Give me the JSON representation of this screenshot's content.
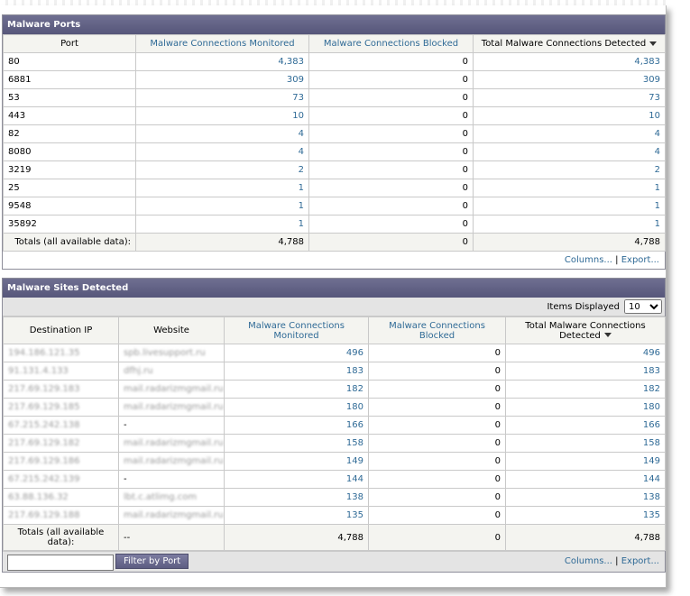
{
  "ports_panel": {
    "title": "Malware Ports",
    "headers": [
      "Port",
      "Malware Connections Monitored",
      "Malware Connections Blocked",
      "Total Malware Connections Detected"
    ],
    "rows": [
      {
        "port": "80",
        "monitored": "4,383",
        "blocked": "0",
        "total": "4,383"
      },
      {
        "port": "6881",
        "monitored": "309",
        "blocked": "0",
        "total": "309"
      },
      {
        "port": "53",
        "monitored": "73",
        "blocked": "0",
        "total": "73"
      },
      {
        "port": "443",
        "monitored": "10",
        "blocked": "0",
        "total": "10"
      },
      {
        "port": "82",
        "monitored": "4",
        "blocked": "0",
        "total": "4"
      },
      {
        "port": "8080",
        "monitored": "4",
        "blocked": "0",
        "total": "4"
      },
      {
        "port": "3219",
        "monitored": "2",
        "blocked": "0",
        "total": "2"
      },
      {
        "port": "25",
        "monitored": "1",
        "blocked": "0",
        "total": "1"
      },
      {
        "port": "9548",
        "monitored": "1",
        "blocked": "0",
        "total": "1"
      },
      {
        "port": "35892",
        "monitored": "1",
        "blocked": "0",
        "total": "1"
      }
    ],
    "totals": {
      "label": "Totals (all available data):",
      "monitored": "4,788",
      "blocked": "0",
      "total": "4,788"
    },
    "columns_link": "Columns...",
    "export_link": "Export..."
  },
  "sites_panel": {
    "title": "Malware Sites Detected",
    "items_label": "Items Displayed",
    "items_value": "10",
    "headers": [
      "Destination IP",
      "Website",
      "Malware Connections Monitored",
      "Malware Connections Blocked",
      "Total Malware Connections Detected"
    ],
    "rows": [
      {
        "ip": "194.186.121.35",
        "site": "spb.livesupport.ru",
        "monitored": "496",
        "blocked": "0",
        "total": "496"
      },
      {
        "ip": "91.131.4.133",
        "site": "dfhj.ru",
        "monitored": "183",
        "blocked": "0",
        "total": "183"
      },
      {
        "ip": "217.69.129.183",
        "site": "mail.radarizmgmail.ru",
        "monitored": "182",
        "blocked": "0",
        "total": "182"
      },
      {
        "ip": "217.69.129.185",
        "site": "mail.radarizmgmail.ru",
        "monitored": "180",
        "blocked": "0",
        "total": "180"
      },
      {
        "ip": "67.215.242.138",
        "site": "-",
        "monitored": "166",
        "blocked": "0",
        "total": "166"
      },
      {
        "ip": "217.69.129.182",
        "site": "mail.radarizmgmail.ru",
        "monitored": "158",
        "blocked": "0",
        "total": "158"
      },
      {
        "ip": "217.69.129.186",
        "site": "mail.radarizmgmail.ru",
        "monitored": "149",
        "blocked": "0",
        "total": "149"
      },
      {
        "ip": "67.215.242.139",
        "site": "-",
        "monitored": "144",
        "blocked": "0",
        "total": "144"
      },
      {
        "ip": "63.88.136.32",
        "site": "lbt.c.atlimg.com",
        "monitored": "138",
        "blocked": "0",
        "total": "138"
      },
      {
        "ip": "217.69.129.188",
        "site": "mail.radarizmgmail.ru",
        "monitored": "135",
        "blocked": "0",
        "total": "135"
      }
    ],
    "totals": {
      "label": "Totals (all available data):",
      "site": "--",
      "monitored": "4,788",
      "blocked": "0",
      "total": "4,788"
    },
    "filter_button": "Filter by Port",
    "filter_value": "",
    "columns_link": "Columns...",
    "export_link": "Export..."
  },
  "colors": {
    "title_bar": "#5e5e84",
    "link": "#2f6a96",
    "header_bg": "#f4f4f0"
  }
}
